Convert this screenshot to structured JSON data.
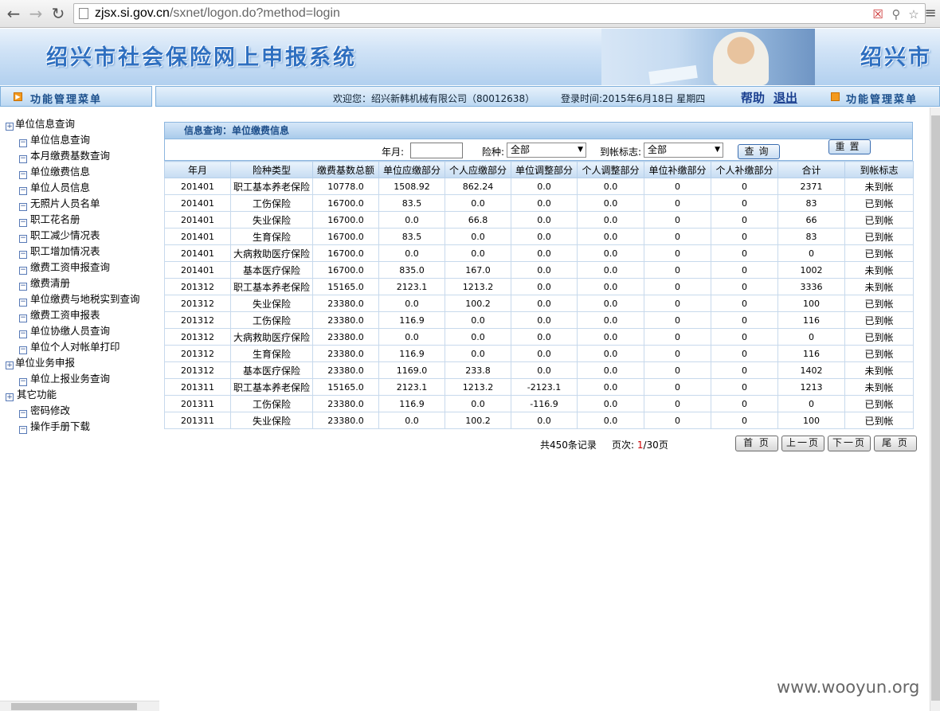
{
  "browser": {
    "url_host": "zjsx.si.gov.cn",
    "url_path": "/sxnet/logon.do?method=login"
  },
  "header": {
    "title": "绍兴市社会保险网上申报系统",
    "title_right": "绍兴市"
  },
  "menubar": {
    "left_label": "功能管理菜单",
    "welcome": "欢迎您：绍兴新韩机械有限公司（80012638）",
    "login_time": "登录时间:2015年6月18日   星期四",
    "help": "帮助",
    "logout": "退出",
    "right_label": "功能管理菜单"
  },
  "sidebar": {
    "groups": [
      {
        "label": "单位信息查询",
        "items": [
          "单位信息查询",
          "本月缴费基数查询",
          "单位缴费信息",
          "单位人员信息",
          "无照片人员名单",
          "职工花名册",
          "职工减少情况表",
          "职工增加情况表",
          "缴费工资申报查询",
          "缴费清册",
          "单位缴费与地税实到查询",
          "缴费工资申报表",
          "单位协缴人员查询",
          "单位个人对帐单打印"
        ]
      },
      {
        "label": "单位业务申报",
        "items": [
          "单位上报业务查询"
        ]
      },
      {
        "label": "其它功能",
        "items": [
          "密码修改",
          "操作手册下载"
        ]
      }
    ]
  },
  "panel": {
    "title": "信息查询：单位缴费信息",
    "search": {
      "month_label": "年月:",
      "month_value": "",
      "insurance_label": "险种:",
      "insurance_value": "全部",
      "arrival_label": "到帐标志:",
      "arrival_value": "全部",
      "query_button": "查询",
      "reset_button": "重置"
    },
    "table": {
      "headers": [
        "年月",
        "险种类型",
        "缴费基数总额",
        "单位应缴部分",
        "个人应缴部分",
        "单位调整部分",
        "个人调整部分",
        "单位补缴部分",
        "个人补缴部分",
        "合计",
        "到帐标志"
      ],
      "rows": [
        [
          "201401",
          "职工基本养老保险",
          "10778.0",
          "1508.92",
          "862.24",
          "0.0",
          "0.0",
          "0",
          "0",
          "2371",
          "未到帐"
        ],
        [
          "201401",
          "工伤保险",
          "16700.0",
          "83.5",
          "0.0",
          "0.0",
          "0.0",
          "0",
          "0",
          "83",
          "已到帐"
        ],
        [
          "201401",
          "失业保险",
          "16700.0",
          "0.0",
          "66.8",
          "0.0",
          "0.0",
          "0",
          "0",
          "66",
          "已到帐"
        ],
        [
          "201401",
          "生育保险",
          "16700.0",
          "83.5",
          "0.0",
          "0.0",
          "0.0",
          "0",
          "0",
          "83",
          "已到帐"
        ],
        [
          "201401",
          "大病救助医疗保险",
          "16700.0",
          "0.0",
          "0.0",
          "0.0",
          "0.0",
          "0",
          "0",
          "0",
          "已到帐"
        ],
        [
          "201401",
          "基本医疗保险",
          "16700.0",
          "835.0",
          "167.0",
          "0.0",
          "0.0",
          "0",
          "0",
          "1002",
          "未到帐"
        ],
        [
          "201312",
          "职工基本养老保险",
          "15165.0",
          "2123.1",
          "1213.2",
          "0.0",
          "0.0",
          "0",
          "0",
          "3336",
          "未到帐"
        ],
        [
          "201312",
          "失业保险",
          "23380.0",
          "0.0",
          "100.2",
          "0.0",
          "0.0",
          "0",
          "0",
          "100",
          "已到帐"
        ],
        [
          "201312",
          "工伤保险",
          "23380.0",
          "116.9",
          "0.0",
          "0.0",
          "0.0",
          "0",
          "0",
          "116",
          "已到帐"
        ],
        [
          "201312",
          "大病救助医疗保险",
          "23380.0",
          "0.0",
          "0.0",
          "0.0",
          "0.0",
          "0",
          "0",
          "0",
          "已到帐"
        ],
        [
          "201312",
          "生育保险",
          "23380.0",
          "116.9",
          "0.0",
          "0.0",
          "0.0",
          "0",
          "0",
          "116",
          "已到帐"
        ],
        [
          "201312",
          "基本医疗保险",
          "23380.0",
          "1169.0",
          "233.8",
          "0.0",
          "0.0",
          "0",
          "0",
          "1402",
          "未到帐"
        ],
        [
          "201311",
          "职工基本养老保险",
          "15165.0",
          "2123.1",
          "1213.2",
          "-2123.1",
          "0.0",
          "0",
          "0",
          "1213",
          "未到帐"
        ],
        [
          "201311",
          "工伤保险",
          "23380.0",
          "116.9",
          "0.0",
          "-116.9",
          "0.0",
          "0",
          "0",
          "0",
          "已到帐"
        ],
        [
          "201311",
          "失业保险",
          "23380.0",
          "0.0",
          "100.2",
          "0.0",
          "0.0",
          "0",
          "0",
          "100",
          "已到帐"
        ]
      ]
    }
  },
  "pager": {
    "total_prefix": "共450条记录",
    "page_label": "页次:",
    "current_page": "1",
    "total_pages": "/30页",
    "first": "首 页",
    "prev": "上一页",
    "next": "下一页",
    "last": "尾 页"
  },
  "watermark": "www.wooyun.org"
}
